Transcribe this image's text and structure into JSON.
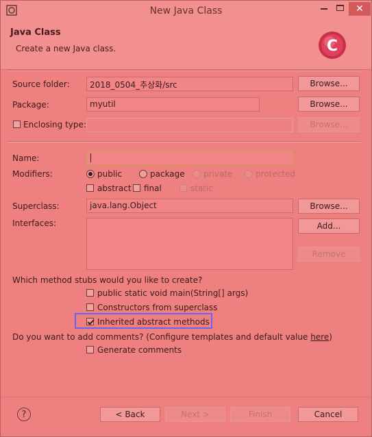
{
  "window": {
    "title": "New Java Class",
    "close_glyph": "✕",
    "min_glyph": "—",
    "max_glyph": "☐"
  },
  "header": {
    "title": "Java Class",
    "description": "Create a new Java class."
  },
  "source_folder": {
    "label": "Source folder:",
    "value": "2018_0504_추상화/src",
    "browse": "Browse..."
  },
  "package": {
    "label": "Package:",
    "value": "myutil",
    "browse": "Browse..."
  },
  "enclosing_type": {
    "label": "Enclosing type:",
    "value": "",
    "browse": "Browse...",
    "checked": false
  },
  "name": {
    "label": "Name:",
    "value": ""
  },
  "modifiers": {
    "label": "Modifiers:",
    "access": [
      "public",
      "package",
      "private",
      "protected"
    ],
    "selected": "public",
    "other": [
      "abstract",
      "final",
      "static"
    ]
  },
  "superclass": {
    "label": "Superclass:",
    "value": "java.lang.Object",
    "browse": "Browse..."
  },
  "interfaces": {
    "label": "Interfaces:",
    "add": "Add...",
    "remove": "Remove"
  },
  "stubs": {
    "question": "Which method stubs would you like to create?",
    "main": "public static void main(String[] args)",
    "constructors": "Constructors from superclass",
    "inherited": "Inherited abstract methods",
    "main_checked": false,
    "constructors_checked": false,
    "inherited_checked": true
  },
  "comments": {
    "question_prefix": "Do you want to add comments? (Configure templates and default value ",
    "link": "here",
    "question_suffix": ")",
    "generate": "Generate comments",
    "generate_checked": false
  },
  "footer": {
    "help": "?",
    "back": "< Back",
    "next": "Next >",
    "finish": "Finish",
    "cancel": "Cancel"
  },
  "colors": {
    "background": "#ee8080",
    "highlight_box": "#6c62f0",
    "close_button": "#d25a5a"
  }
}
